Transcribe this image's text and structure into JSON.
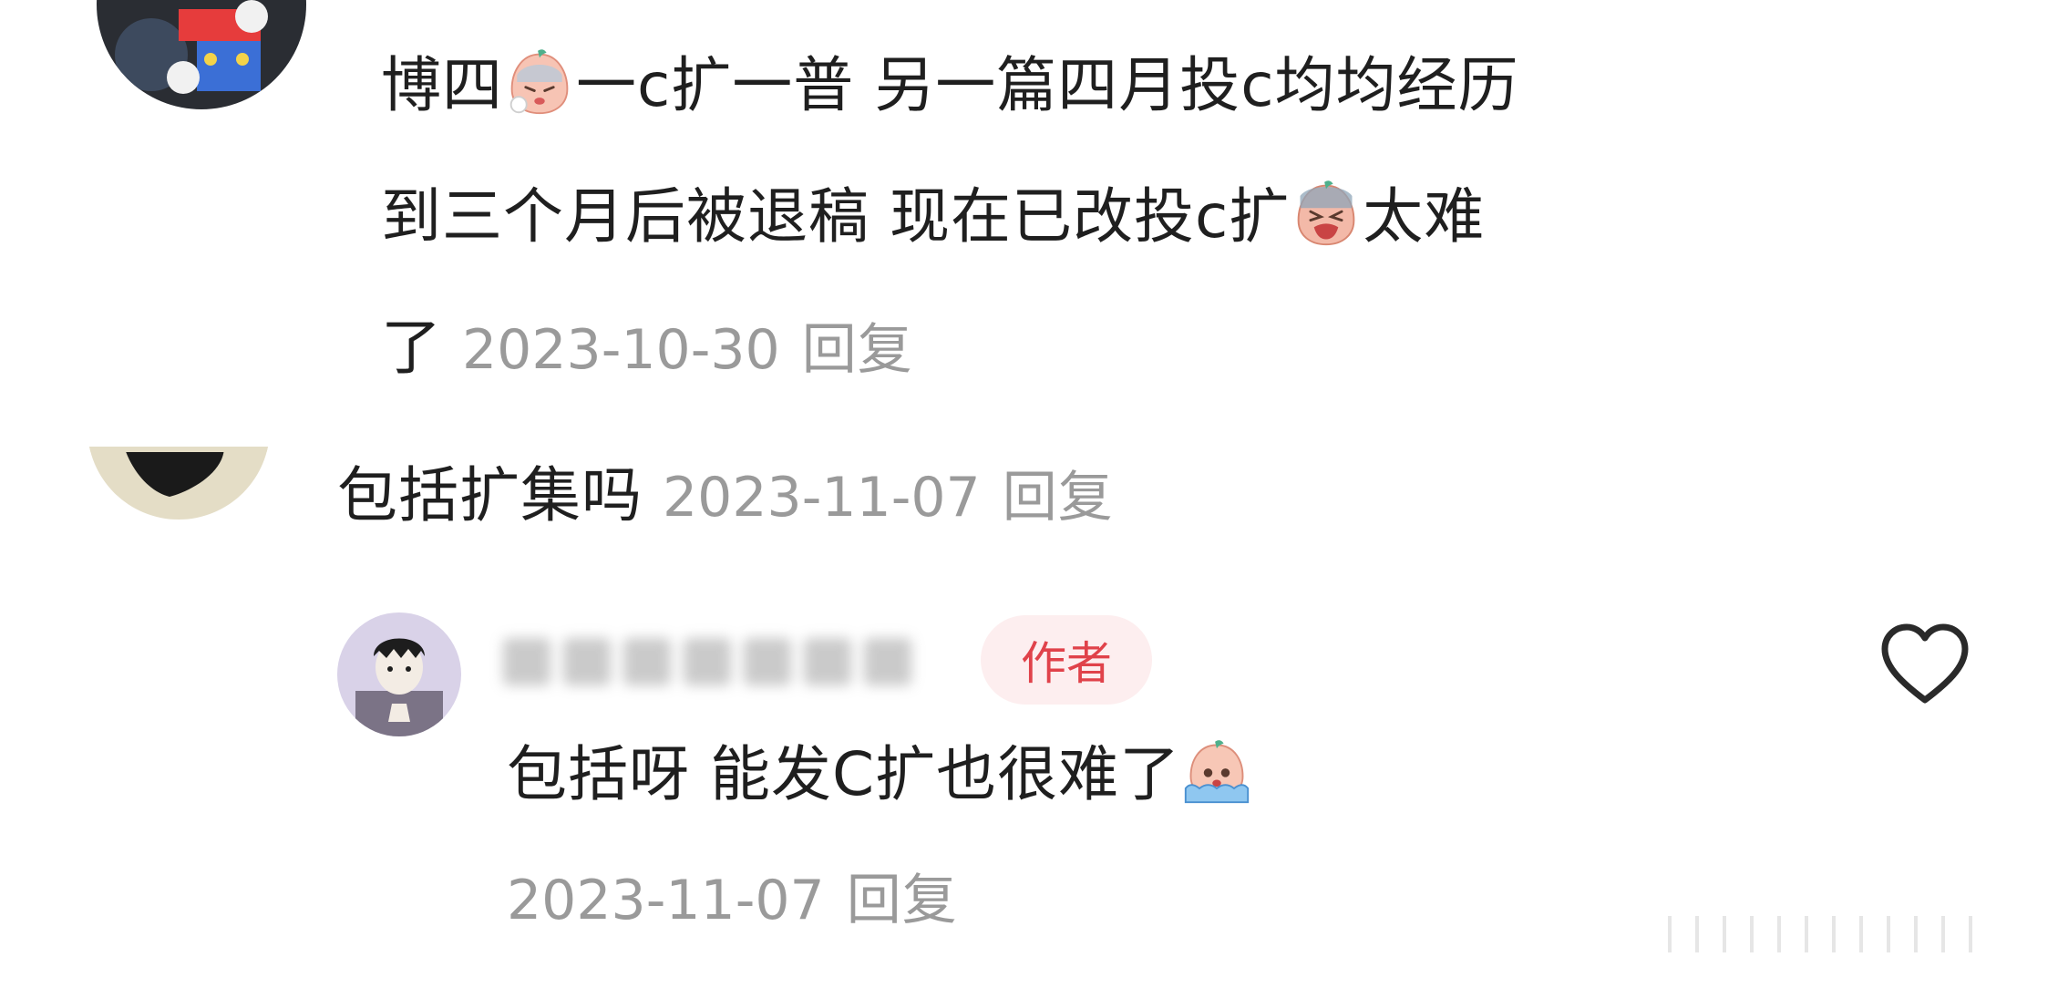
{
  "comment1": {
    "line1": {
      "a": "博四",
      "b": "一c扩一普 另一篇四月投c均均经历"
    },
    "line2": {
      "a": "到三个月后被退稿 现在已改投c扩",
      "b": "太难"
    },
    "line3": {
      "a": "了",
      "date": "2023-10-30",
      "reply": "回复"
    },
    "emojis": [
      "sweat-face-emoji",
      "crying-face-emoji"
    ]
  },
  "comment2": {
    "text": "包括扩集吗",
    "date": "2023-11-07",
    "reply": "回复"
  },
  "author_reply": {
    "badge": "作者",
    "text": "包括呀 能发C扩也很难了",
    "date": "2023-11-07",
    "reply": "回复",
    "emoji": "tears-face-emoji",
    "like_icon": "heart-outline-icon"
  },
  "colors": {
    "badge_bg": "#fdeeef",
    "badge_text": "#e0424a",
    "meta_text": "#9a9a9a",
    "body_text": "#1f1f1f"
  }
}
